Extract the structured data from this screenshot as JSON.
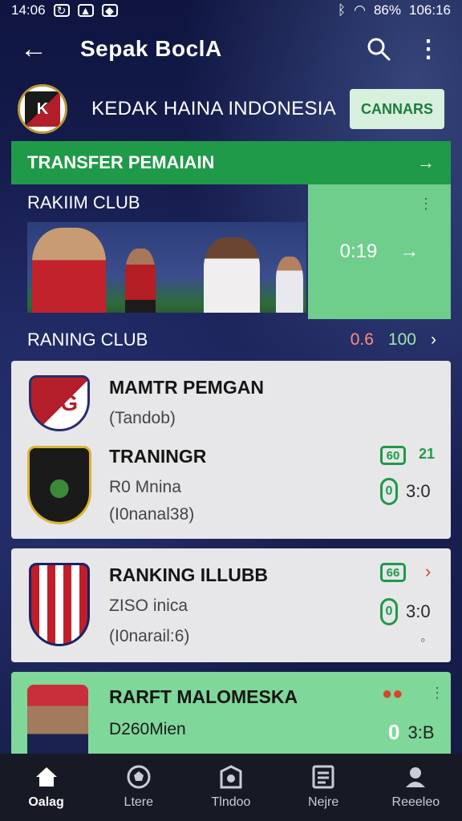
{
  "status_bar": {
    "time": "14:06",
    "battery": "86%",
    "clock_right": "106:16"
  },
  "app_bar": {
    "title": "Sepak BoclA"
  },
  "league": {
    "name": "KEDAK HAINA INDONESIA",
    "button_label": "CANNARS",
    "logo_letter": "K"
  },
  "transfer": {
    "label": "TRANSFER PEMAIAIN"
  },
  "ranking": {
    "title": "RAKIIM CLUB",
    "hero_time": "0:19"
  },
  "raning": {
    "title": "RANING CLUB",
    "stat_red": "0.6",
    "stat_green": "100"
  },
  "cards": [
    {
      "title": "MAMTR PEMGAN",
      "sub": "(Tandob)",
      "title2": "TRANINGR",
      "sub2": "R0 Mnina",
      "sub3": "(I0nanal38)",
      "badge": "60",
      "side_num": "21",
      "score": "3:0",
      "pill": "0"
    },
    {
      "title": "RANKING ILLUBB",
      "sub": "ZISO inica",
      "sub2": "(I0narail:6)",
      "badge": "66",
      "score": "3:0",
      "pill": "0"
    },
    {
      "title": "RARFT MALOMESKA",
      "sub": "D260Mien",
      "score": "3:B",
      "pill": "0"
    }
  ],
  "nav": [
    {
      "label": "Oalag",
      "icon": "home-icon"
    },
    {
      "label": "Ltere",
      "icon": "ball-icon"
    },
    {
      "label": "Tlndoo",
      "icon": "shield-icon"
    },
    {
      "label": "Nejre",
      "icon": "news-icon"
    },
    {
      "label": "Reeeleo",
      "icon": "profile-icon"
    }
  ],
  "colors": {
    "green": "#1f9a48",
    "light_green": "#7fd79a",
    "navy": "#141a44"
  }
}
